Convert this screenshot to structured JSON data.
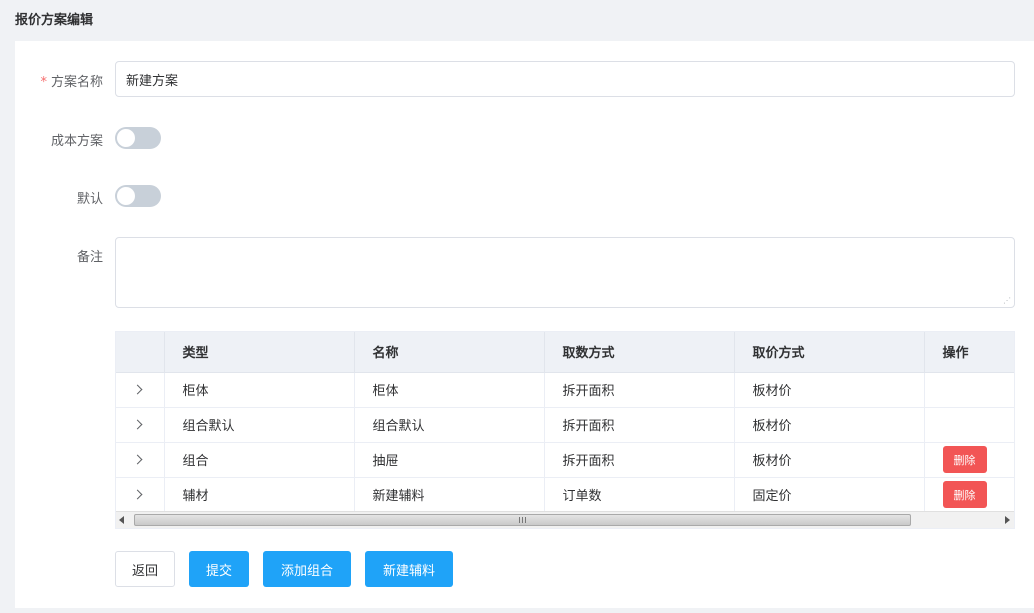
{
  "page": {
    "title": "报价方案编辑"
  },
  "form": {
    "name_label": "方案名称",
    "name_required_mark": "*",
    "name_value": "新建方案",
    "cost_label": "成本方案",
    "cost_on": false,
    "default_label": "默认",
    "default_on": false,
    "remark_label": "备注",
    "remark_value": ""
  },
  "table": {
    "headers": [
      "类型",
      "名称",
      "取数方式",
      "取价方式",
      "操作"
    ],
    "rows": [
      {
        "type": "柜体",
        "name": "柜体",
        "fetch": "拆开面积",
        "price": "板材价",
        "action": ""
      },
      {
        "type": "组合默认",
        "name": "组合默认",
        "fetch": "拆开面积",
        "price": "板材价",
        "action": ""
      },
      {
        "type": "组合",
        "name": "抽屉",
        "fetch": "拆开面积",
        "price": "板材价",
        "action": "删除"
      },
      {
        "type": "辅材",
        "name": "新建辅料",
        "fetch": "订单数",
        "price": "固定价",
        "action": "删除"
      }
    ]
  },
  "buttons": {
    "back": "返回",
    "submit": "提交",
    "add_group": "添加组合",
    "new_material": "新建辅料"
  },
  "colors": {
    "primary": "#1fa3f8",
    "danger": "#f25555",
    "switch_off": "#c8d0d9"
  }
}
